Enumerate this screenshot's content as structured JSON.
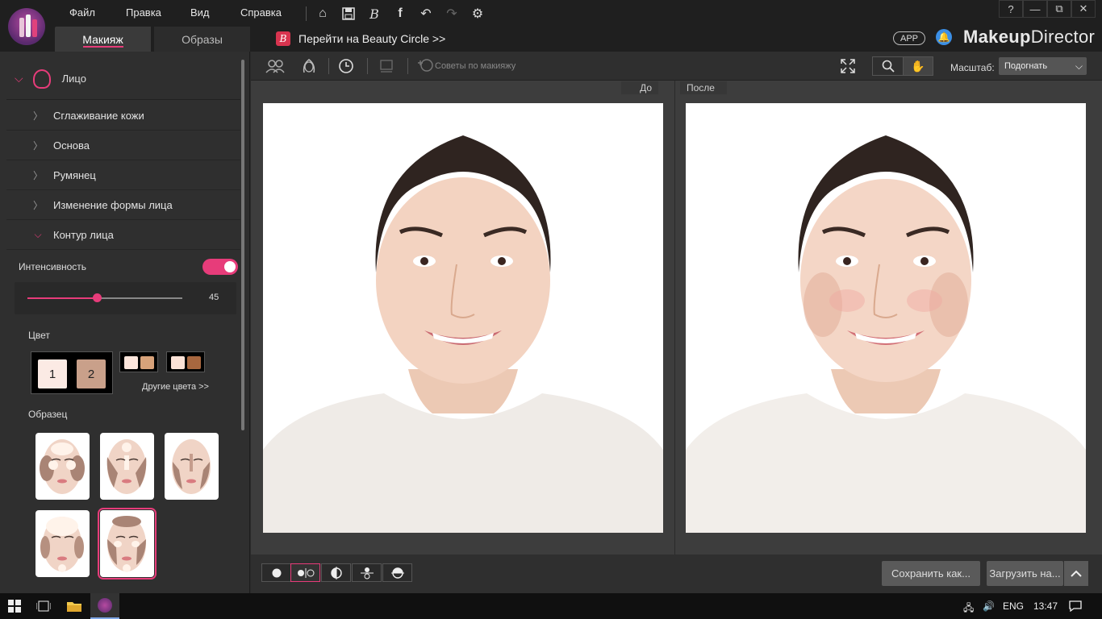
{
  "menu": {
    "file": "Файл",
    "edit": "Правка",
    "view": "Вид",
    "help": "Справка"
  },
  "window_buttons": {
    "help": "?",
    "minimize": "—",
    "restore": "⧉",
    "close": "✕"
  },
  "tabs": {
    "makeup": "Макияж",
    "looks": "Образы"
  },
  "beauty_circle": {
    "badge": "B",
    "label": "Перейти на Beauty Circle >>"
  },
  "header_right": {
    "app_pill": "APP",
    "brand_bold": "Makeup",
    "brand_rest": "Director"
  },
  "left_panel": {
    "section_title": "Лицо",
    "categories": [
      {
        "label": "Сглаживание кожи",
        "open": false
      },
      {
        "label": "Основа",
        "open": false
      },
      {
        "label": "Румянец",
        "open": false
      },
      {
        "label": "Изменение формы лица",
        "open": false
      },
      {
        "label": "Контур лица",
        "open": true
      }
    ],
    "intensity_label": "Интенсивность",
    "toggle_on": true,
    "slider_value": 45,
    "slider_max": 100,
    "color_label": "Цвет",
    "palette_numbers": [
      "1",
      "2"
    ],
    "palette_colors": [
      "#fbeae4",
      "#c9a08a"
    ],
    "mini_palettes": [
      [
        "#fde6dc",
        "#d7a27a"
      ],
      [
        "#fbe2d6",
        "#a8673f"
      ]
    ],
    "more_colors": "Другие цвета >>",
    "sample_label": "Образец",
    "selected_sample": 5
  },
  "toolbar": {
    "tips": "Советы по макияжу",
    "scale_label": "Масштаб:",
    "scale_value": "Подогнать",
    "icons": [
      "faces-icon",
      "face-outline-icon",
      "history-icon",
      "compare-icon",
      "tips-icon",
      "fullscreen-icon",
      "zoom-icon",
      "hand-icon"
    ]
  },
  "panes": {
    "before": "До",
    "after": "После"
  },
  "bottom": {
    "save": "Сохранить как...",
    "upload": "Загрузить на...",
    "view_modes": [
      "single",
      "side-by-side",
      "split-vertical",
      "split-horizontal",
      "split-flip"
    ],
    "active_view": 1
  },
  "taskbar": {
    "lang": "ENG",
    "time": "13:47"
  },
  "colors": {
    "accent": "#e73c7a",
    "panel": "#2f2f2f",
    "canvas": "#3d3d3d",
    "brand_blue": "#3b8fe6"
  }
}
